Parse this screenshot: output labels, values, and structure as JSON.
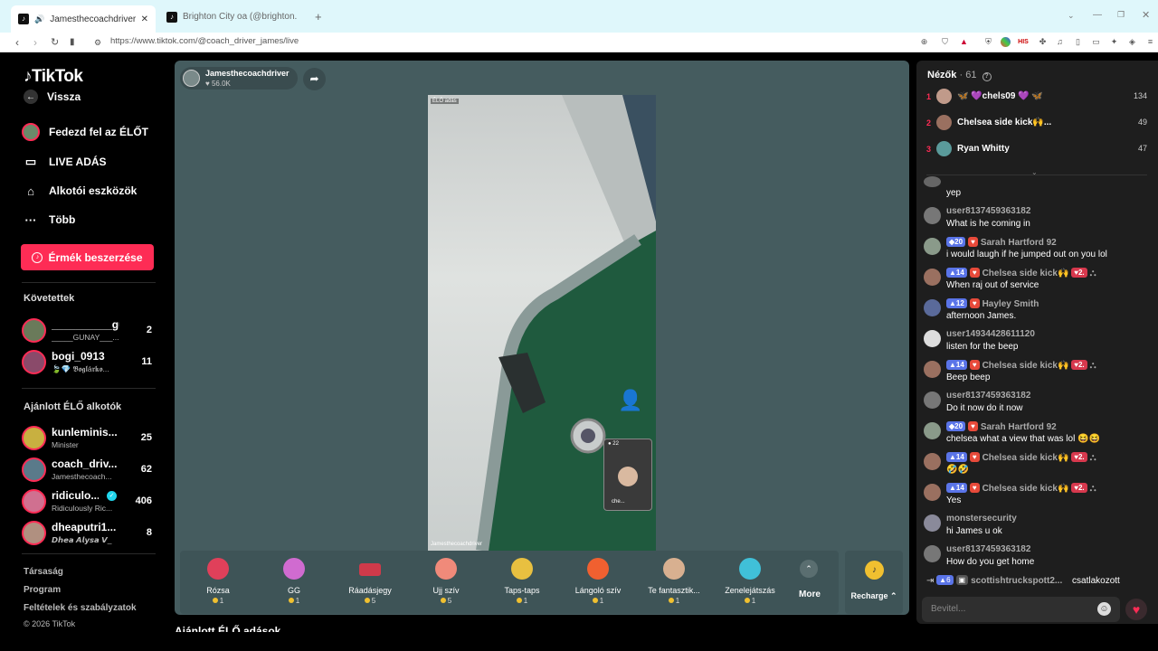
{
  "browser": {
    "tabs": [
      {
        "label": "Jamesthecoachdriver (@coac",
        "close": "✕"
      },
      {
        "label": "Brighton City oa (@brighton.city) ÉLŐ",
        "close": ""
      }
    ],
    "new_tab": "+",
    "url": "https://www.tiktok.com/@coach_driver_james/live"
  },
  "sidebar": {
    "logo": "TikTok",
    "back": "Vissza",
    "nav": [
      {
        "label": "Fedezd fel az ÉLŐT",
        "icon": "live-explore-icon"
      },
      {
        "label": "LIVE ADÁS",
        "icon": "camera-icon"
      },
      {
        "label": "Alkotói eszközök",
        "icon": "creator-tools-icon"
      },
      {
        "label": "Több",
        "icon": "more-dots-icon"
      }
    ],
    "coins_button": "Érmék beszerzése",
    "following_title": "Követettek",
    "following": [
      {
        "name": "__________gu...",
        "sub": "_____GUNAY___...",
        "count": "2"
      },
      {
        "name": "bogi_0913",
        "sub": "🍃💎 𝕭𝖔𝖌𝖑á𝖗𝖐𝖔...",
        "count": "11"
      }
    ],
    "recommended_title": "Ajánlott ÉLŐ alkotók",
    "recommended": [
      {
        "name": "kunleminis...",
        "sub": "Minister",
        "count": "25"
      },
      {
        "name": "coach_driv...",
        "sub": "Jamesthecoach...",
        "count": "62"
      },
      {
        "name": "ridiculo...",
        "sub": "Ridiculously Ric...",
        "count": "406"
      },
      {
        "name": "dheaputri1...",
        "sub": "𝘿𝙝𝙚𝙖 𝘼𝙡𝙮𝙨𝙖 𝙑_",
        "count": "8"
      }
    ],
    "footer": [
      "Társaság",
      "Program",
      "Feltételek és szabályzatok",
      "© 2026 TikTok"
    ],
    "live_badge": "ÉLŐ"
  },
  "stream": {
    "host_name": "Jamesthecoachdriver",
    "host_likes": "56.0K",
    "video_tag": "ÉLŐ adás",
    "watermark": "Jamesthecoachdriver",
    "pip_count": "22",
    "pip_label": "che...",
    "bottom_heading": "Ajánlott ÉLŐ adások"
  },
  "gifts": [
    {
      "name": "Rózsa",
      "price": "1",
      "color": "#e0405a"
    },
    {
      "name": "GG",
      "price": "1",
      "color": "#d06bd0"
    },
    {
      "name": "Ráadásjegy",
      "price": "5",
      "color": "#d03a4a"
    },
    {
      "name": "Ujj szív",
      "price": "5",
      "color": "#f08a7a"
    },
    {
      "name": "Taps-taps",
      "price": "1",
      "color": "#e8c040"
    },
    {
      "name": "Lángoló szív",
      "price": "1",
      "color": "#f06030"
    },
    {
      "name": "Te fantasztik...",
      "price": "1",
      "color": "#d8b090"
    },
    {
      "name": "Zenelejátszás",
      "price": "1",
      "color": "#40c0d8"
    }
  ],
  "more_label": "More",
  "recharge_label": "Recharge",
  "chat": {
    "viewers_label": "Nézők",
    "viewers_count": "61",
    "top_viewers": [
      {
        "rank": "1",
        "name": "🦋 💜chels09 💜 🦋",
        "score": "134"
      },
      {
        "rank": "2",
        "name": "Chelsea side kick🙌...",
        "score": "49"
      },
      {
        "rank": "3",
        "name": "Ryan Whitty",
        "score": "47"
      }
    ],
    "messages": [
      {
        "user": "",
        "text": "yep",
        "level": "",
        "fan": ""
      },
      {
        "user": "user8137459363182",
        "text": "What is he coming in",
        "level": "",
        "fan": ""
      },
      {
        "user": "Sarah Hartford 92",
        "text": "i would laugh if he jumped out on you lol",
        "level": "20",
        "fan": ""
      },
      {
        "user": "Chelsea side kick🙌",
        "text": "When raj out of service",
        "level": "14",
        "fan": "2."
      },
      {
        "user": "Hayley Smith",
        "text": "afternoon James.",
        "level": "12",
        "fan": ""
      },
      {
        "user": "user14934428611120",
        "text": "listen for the beep",
        "level": "",
        "fan": ""
      },
      {
        "user": "Chelsea side kick🙌",
        "text": "Beep beep",
        "level": "14",
        "fan": "2."
      },
      {
        "user": "user8137459363182",
        "text": "Do it now do it now",
        "level": "",
        "fan": ""
      },
      {
        "user": "Sarah Hartford 92",
        "text": "chelsea what a view that was lol 😆😆",
        "level": "20",
        "fan": ""
      },
      {
        "user": "Chelsea side kick🙌",
        "text": "🤣🤣",
        "level": "14",
        "fan": "2."
      },
      {
        "user": "Chelsea side kick🙌",
        "text": "Yes",
        "level": "14",
        "fan": "2."
      },
      {
        "user": "monstersecurity",
        "text": "hi James u ok",
        "level": "",
        "fan": ""
      },
      {
        "user": "user8137459363182",
        "text": "How do you get home",
        "level": "",
        "fan": ""
      }
    ],
    "join_user": "scottishtruckspott2...",
    "join_level": "6",
    "join_text": "csatlakozott",
    "input_placeholder": "Bevitel..."
  }
}
